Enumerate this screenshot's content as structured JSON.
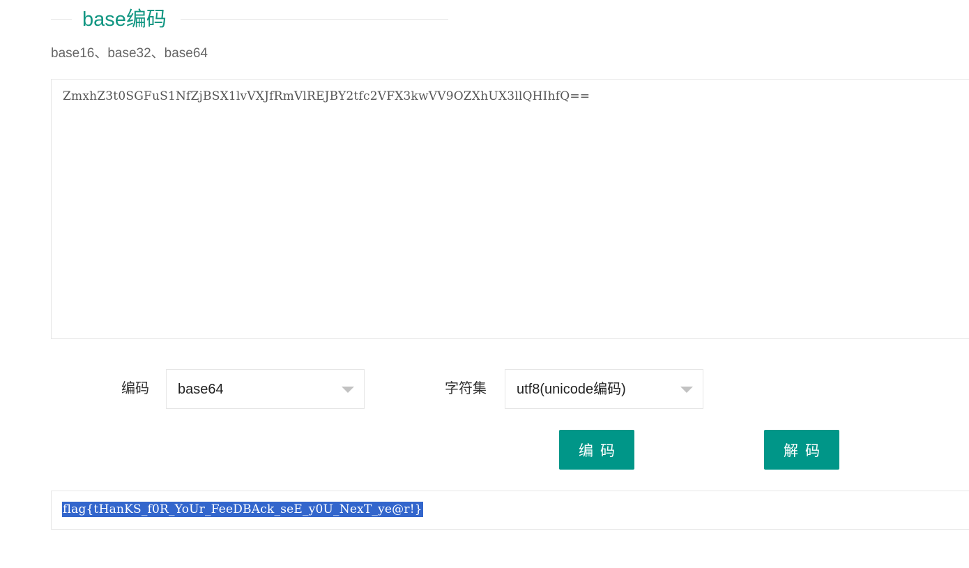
{
  "page": {
    "title": "base编码",
    "subtitle": "base16、base32、base64"
  },
  "input": {
    "value": "ZmxhZ3t0SGFuS1NfZjBSX1lvVXJfRmVlREJBY2tfc2VFX3kwVV9OZXhUX3llQHIhfQ=="
  },
  "options": {
    "encoding_label": "编码",
    "encoding_value": "base64",
    "charset_label": "字符集",
    "charset_value": "utf8(unicode编码)"
  },
  "buttons": {
    "encode_label": "编码",
    "decode_label": "解码"
  },
  "output": {
    "value": "flag{tHanKS_f0R_YoUr_FeeDBAck_seE_y0U_NexT_ye@r!}"
  },
  "colors": {
    "accent": "#009688",
    "title": "#119682",
    "selection": "#3366cc"
  },
  "icons": {
    "select_caret": "caret-down-icon"
  }
}
